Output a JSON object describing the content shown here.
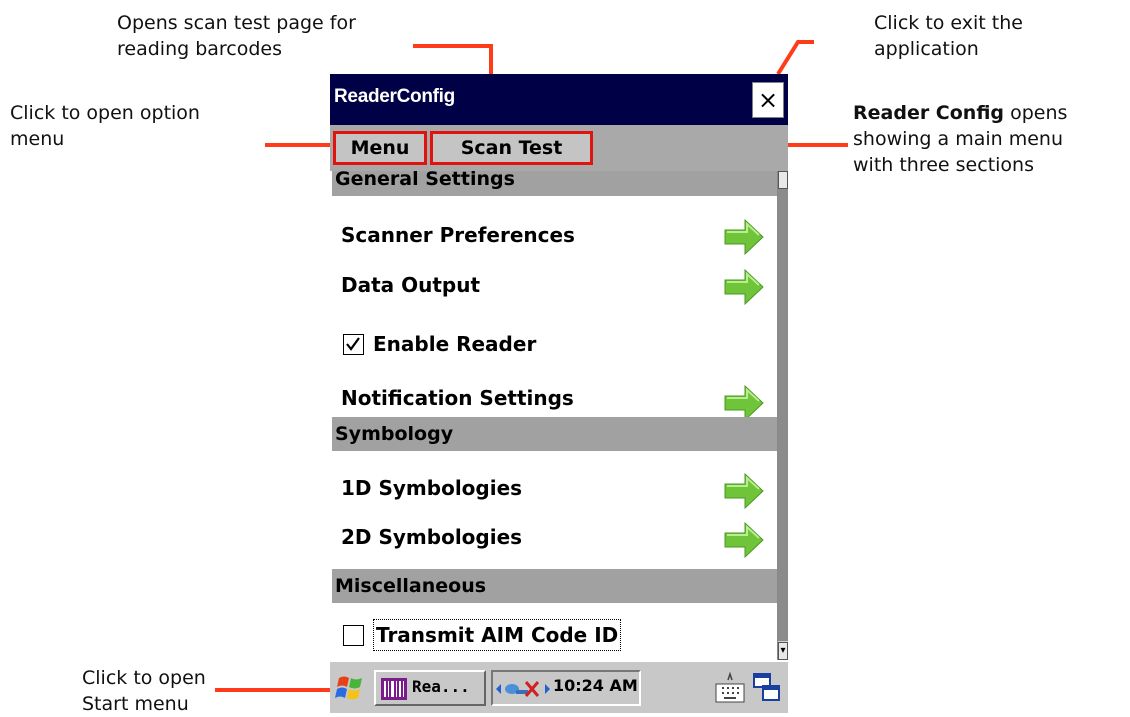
{
  "annotations": {
    "scan_test_callout": "Opens scan test page for\nreading barcodes",
    "exit_callout": "Click to exit the\napplication",
    "menu_callout": "Click to open option\nmenu",
    "main_menu_callout_bold": "Reader Config",
    "main_menu_callout_rest": " opens\nshowing a main menu\nwith three sections",
    "start_callout": "Click to open\nStart menu"
  },
  "window": {
    "title": "ReaderConfig",
    "close_glyph": "×"
  },
  "menubar": {
    "menu_label": "Menu",
    "scan_test_label": "Scan Test"
  },
  "sections": [
    {
      "header": "General Settings",
      "items": [
        {
          "label": "Scanner Preferences",
          "type": "link"
        },
        {
          "label": "Data Output",
          "type": "link"
        },
        {
          "label": "Enable Reader",
          "type": "checkbox",
          "checked": true
        },
        {
          "label": "Notification Settings",
          "type": "link"
        }
      ]
    },
    {
      "header": "Symbology",
      "items": [
        {
          "label": "1D Symbologies",
          "type": "link"
        },
        {
          "label": "2D Symbologies",
          "type": "link"
        }
      ]
    },
    {
      "header": "Miscellaneous",
      "items": [
        {
          "label": "Transmit AIM Code ID",
          "type": "checkbox",
          "checked": false
        }
      ]
    }
  ],
  "taskbar": {
    "app_label": "Rea...",
    "clock": "10:24 AM"
  },
  "colors": {
    "title_bg": "#000046",
    "highlight": "#e0130f",
    "callout_line": "#ff3b1a",
    "arrow_green": "#6fc43a"
  },
  "icons": [
    "start-flag-icon",
    "close-icon",
    "right-arrow-icon",
    "checkbox-icon",
    "network-icon",
    "keyboard-icon",
    "task-switch-icon"
  ]
}
